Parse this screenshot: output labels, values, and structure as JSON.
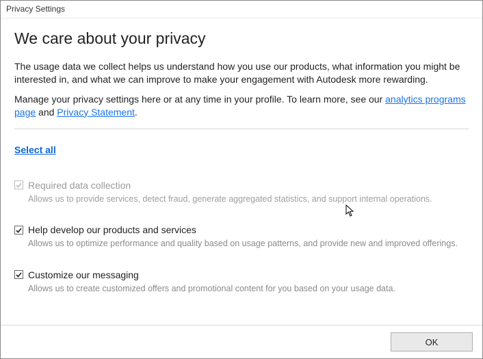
{
  "window_title": "Privacy Settings",
  "heading": "We care about your privacy",
  "intro1": "The usage data we collect helps us understand how you use our products, what information you might be interested in, and what we can improve to make your engagement with Autodesk more rewarding.",
  "intro2_prefix": "Manage your privacy settings here or at any time in your profile. To learn more, see our ",
  "intro2_link1": "analytics programs page",
  "intro2_mid": " and ",
  "intro2_link2": "Privacy Statement",
  "intro2_suffix": ".",
  "select_all_label": "Select all",
  "options": {
    "required": {
      "label": "Required data collection",
      "desc": "Allows us to provide services, detect fraud, generate aggregated statistics, and support internal operations."
    },
    "develop": {
      "label": "Help develop our products and services",
      "desc": "Allows us to optimize performance and quality based on usage patterns, and provide new and improved offerings."
    },
    "messaging": {
      "label": "Customize our messaging",
      "desc": "Allows us to create customized offers and promotional content for you based on your usage data."
    }
  },
  "ok_label": "OK"
}
